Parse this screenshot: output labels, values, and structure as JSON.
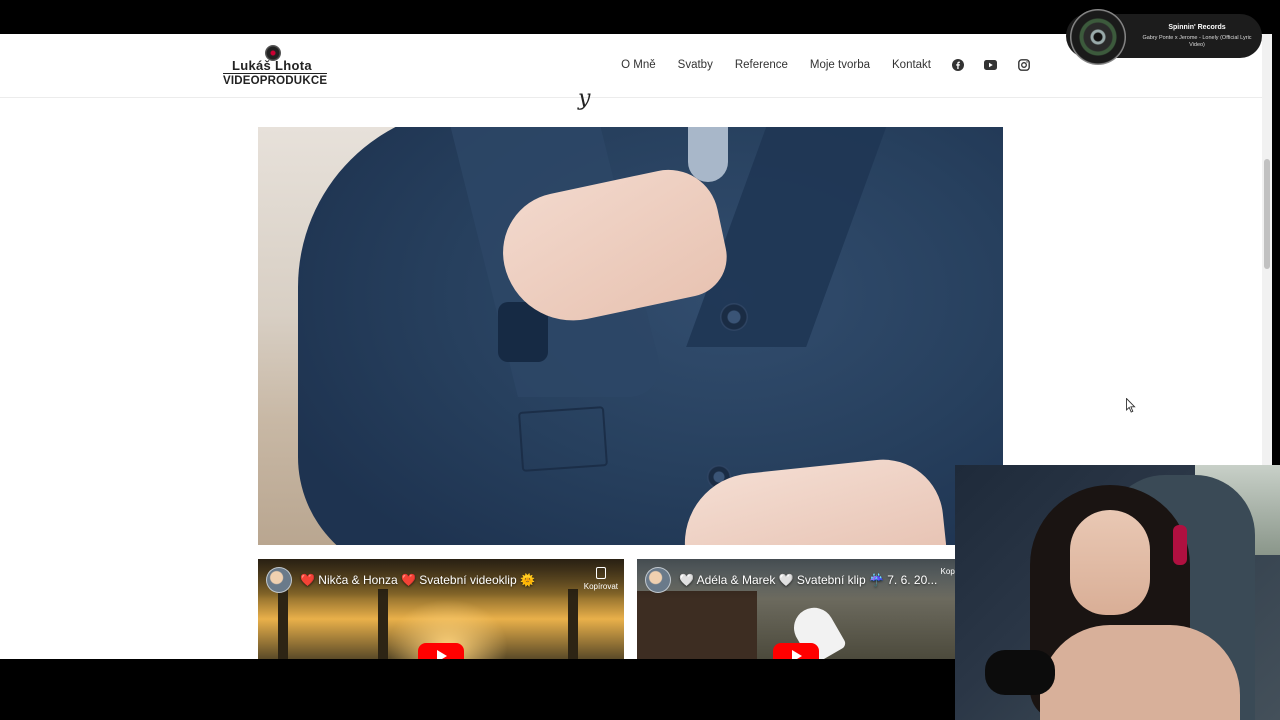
{
  "header": {
    "logo_name": "Lukáš  Lhota",
    "logo_sub": "VIDEOPRODUKCE",
    "nav": [
      "O Mně",
      "Svatby",
      "Reference",
      "Moje tvorba",
      "Kontakt"
    ],
    "social_icons": [
      "facebook-icon",
      "youtube-icon",
      "instagram-icon"
    ]
  },
  "videos": [
    {
      "title": "❤️ Nikča & Honza ❤️ Svatební videoklip 🌞",
      "copy_label": "Kopírovat"
    },
    {
      "title": "🤍 Adéla & Marek 🤍 Svatební klip ☔ 7. 6. 20...",
      "copy_label": "Kopí"
    }
  ],
  "music": {
    "artist": "Spinnin' Records",
    "track": "Gabry Ponte x Jerome - Lonely (Official Lyric Video)"
  },
  "colors": {
    "brand_accent": "#c00030",
    "youtube_red": "#ff0000"
  }
}
